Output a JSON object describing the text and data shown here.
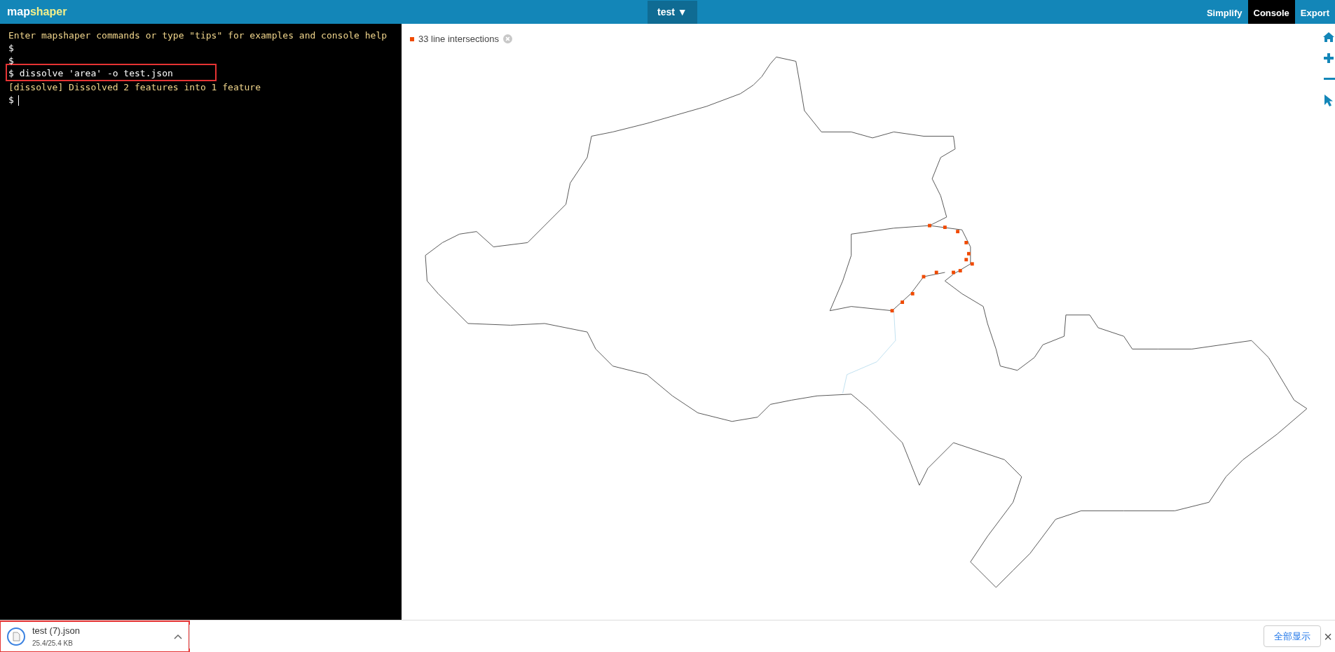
{
  "topbar": {
    "logo": [
      "map",
      "shaper"
    ],
    "layer_menu": {
      "label": "test",
      "caret": "▼"
    },
    "tabs": [
      {
        "label": "Simplify",
        "selected": false
      },
      {
        "label": "Console",
        "selected": true
      },
      {
        "label": "Export",
        "selected": false
      }
    ]
  },
  "console": {
    "lines": [
      {
        "kind": "message",
        "text": "Enter mapshaper commands or type \"tips\" for examples and console help"
      },
      {
        "kind": "prompt",
        "prompt": "$"
      },
      {
        "kind": "prompt",
        "prompt": "$"
      },
      {
        "kind": "prompt",
        "prompt": "$",
        "text": "dissolve 'area' -o test.json",
        "highlighted": true
      },
      {
        "kind": "message",
        "text": "[dissolve] Dissolved 2 features into 1 feature"
      },
      {
        "kind": "input",
        "prompt": "$"
      }
    ]
  },
  "map": {
    "intersections": {
      "label": "33 line intersections"
    }
  },
  "download_bar": {
    "item": {
      "file_name": "test (7).json",
      "progress": "25.4/25.4 KB",
      "highlighted": true
    },
    "show_all_button": "全部显示",
    "close": "×"
  }
}
